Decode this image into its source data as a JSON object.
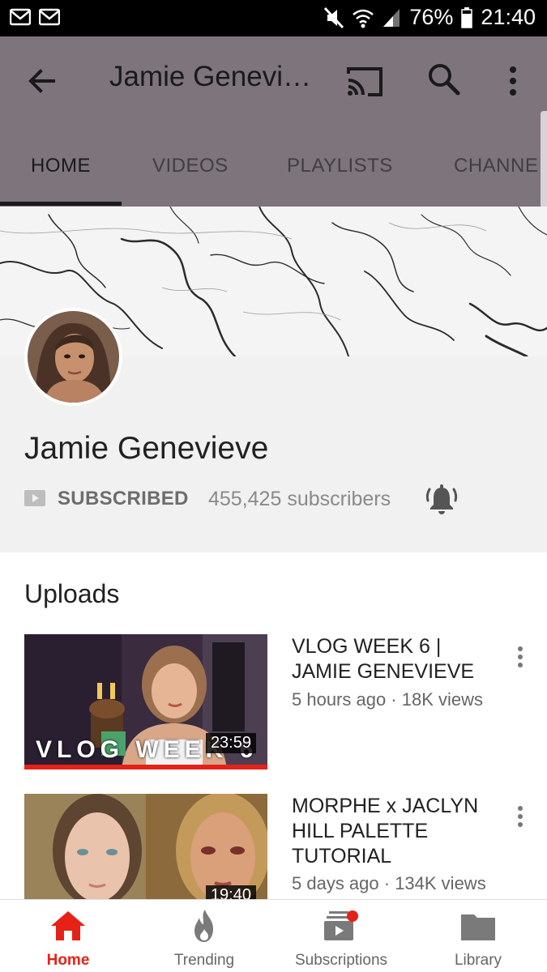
{
  "status_bar": {
    "battery": "76%",
    "time": "21:40",
    "icons": [
      "mail-icon",
      "mail-icon",
      "mute-icon",
      "wifi-icon",
      "signal-icon",
      "battery-icon"
    ]
  },
  "app_bar": {
    "title": "Jamie Genevi…",
    "icons": [
      "back-arrow-icon",
      "cast-icon",
      "search-icon",
      "more-vert-icon"
    ]
  },
  "tabs": [
    {
      "label": "HOME",
      "active": true
    },
    {
      "label": "VIDEOS",
      "active": false
    },
    {
      "label": "PLAYLISTS",
      "active": false
    },
    {
      "label": "CHANNE",
      "active": false
    }
  ],
  "channel": {
    "name": "Jamie Genevieve",
    "subscribed_label": "SUBSCRIBED",
    "subscribers": "455,425 subscribers"
  },
  "uploads": {
    "title": "Uploads",
    "videos": [
      {
        "title": "VLOG WEEK 6 | JAMIE GENEVIEVE",
        "meta": "5 hours ago · 18K views",
        "duration": "23:59",
        "thumb_overlay_text": "VLOG WEEK 6"
      },
      {
        "title": "MORPHE x JACLYN HILL PALETTE TUTORIAL",
        "meta": "5 days ago · 134K views",
        "duration": "19:40"
      }
    ]
  },
  "bottom_nav": [
    {
      "label": "Home",
      "icon": "home-icon",
      "active": true
    },
    {
      "label": "Trending",
      "icon": "trending-flame-icon",
      "active": false
    },
    {
      "label": "Subscriptions",
      "icon": "subscriptions-icon",
      "active": false
    },
    {
      "label": "Library",
      "icon": "library-folder-icon",
      "active": false
    }
  ],
  "colors": {
    "app_bar": "#7d747c",
    "accent_red": "#e62117",
    "header_bg": "#f1f1f1"
  }
}
